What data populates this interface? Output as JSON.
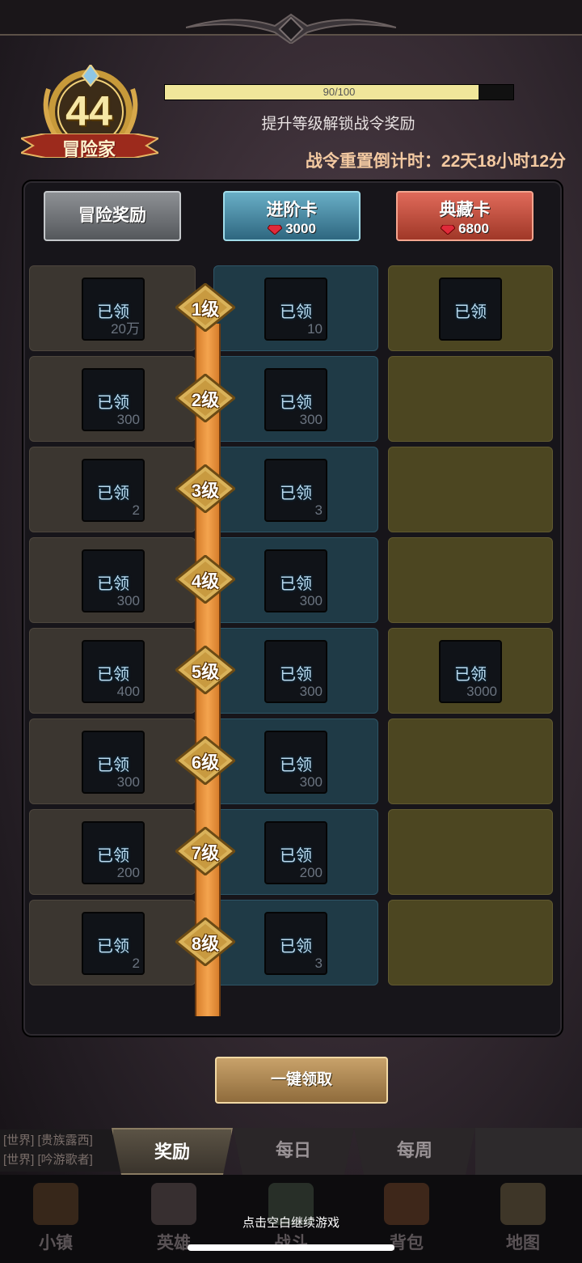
{
  "player": {
    "level": "44",
    "title": "冒险家"
  },
  "progress": {
    "text": "90/100",
    "value": 90,
    "max": 100
  },
  "hint": "提升等级解锁战令奖励",
  "countdown": "战令重置倒计时：22天18小时12分",
  "columns": {
    "adventure": {
      "label": "冒险奖励"
    },
    "advanced": {
      "label": "进阶卡",
      "price": "3000"
    },
    "collector": {
      "label": "典藏卡",
      "price": "6800"
    }
  },
  "claimed_label": "已领",
  "rows": [
    {
      "level": "1级",
      "free": "20万",
      "adv": "10",
      "col": ""
    },
    {
      "level": "2级",
      "free": "300",
      "adv": "300",
      "col": null
    },
    {
      "level": "3级",
      "free": "2",
      "adv": "3",
      "col": null
    },
    {
      "level": "4级",
      "free": "300",
      "adv": "300",
      "col": null
    },
    {
      "level": "5级",
      "free": "400",
      "adv": "300",
      "col": "3000"
    },
    {
      "level": "6级",
      "free": "300",
      "adv": "300",
      "col": null
    },
    {
      "level": "7级",
      "free": "200",
      "adv": "200",
      "col": null
    },
    {
      "level": "8级",
      "free": "2",
      "adv": "3",
      "col": null
    }
  ],
  "claim_all": "一键领取",
  "chat": [
    "[世界] [贵族露西]",
    "[世界] [吟游歌者]"
  ],
  "bottom_tabs": {
    "rewards": "奖励",
    "daily": "每日",
    "weekly": "每周"
  },
  "nav": {
    "town": "小镇",
    "heroes": "英雄",
    "battle": "战斗",
    "bag": "背包",
    "map": "地图"
  },
  "continue_hint": "点击空白继续游戏",
  "colors": {
    "accent_gold": "#f0e69a",
    "countdown": "#f3c9a1",
    "spine": "#f4a44e"
  }
}
